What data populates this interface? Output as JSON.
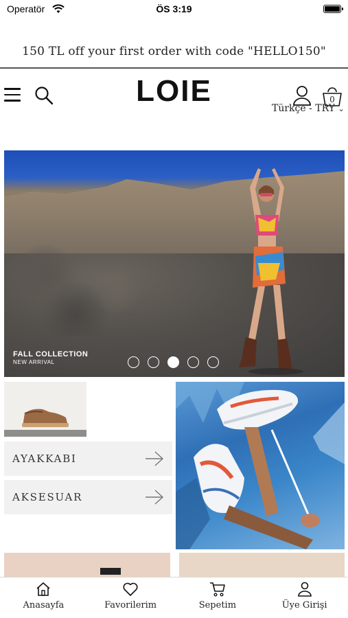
{
  "status": {
    "carrier": "Operatör",
    "time": "ÖS 3:19"
  },
  "promo": {
    "text": "150 TL off your first order with code \"HELLO150\""
  },
  "header": {
    "logo": "LOIE",
    "cart_count": "0",
    "language_currency": "Türkçe - TRY"
  },
  "hero": {
    "title": "FALL COLLECTION",
    "subtitle": "NEW ARRIVAL",
    "slides": 5,
    "active_slide": 3
  },
  "categories": [
    {
      "label": "AYAKKABI"
    },
    {
      "label": "AKSESUAR"
    }
  ],
  "tabbar": {
    "items": [
      {
        "label": "Anasayfa",
        "icon": "home-icon"
      },
      {
        "label": "Favorilerim",
        "icon": "heart-icon"
      },
      {
        "label": "Sepetim",
        "icon": "cart-icon"
      },
      {
        "label": "Üye Girişi",
        "icon": "user-icon"
      }
    ]
  }
}
